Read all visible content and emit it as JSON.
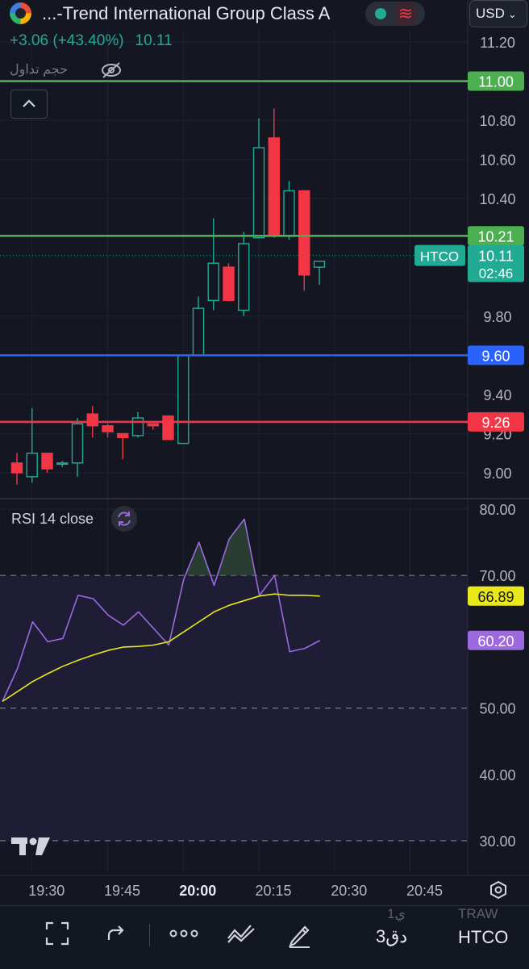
{
  "header": {
    "symbol_name": "...-Trend International Group Class A",
    "change": "+3.06 (+43.40%)",
    "last_price": "10.11",
    "volume_label": "حجم تداول",
    "currency": "USD",
    "currency_chevron": "⌄"
  },
  "colors": {
    "up": "#22ab94",
    "down": "#f23645",
    "green_line": "#4caf50",
    "blue_line": "#2962ff",
    "red_line": "#f23645",
    "rsi": "#9c6ade",
    "rsi_ma": "#e8e81a"
  },
  "price_axis": {
    "ticks": [
      "11.20",
      "10.80",
      "10.60",
      "10.40",
      "9.80",
      "9.40",
      "9.20",
      "9.00"
    ],
    "ylim": [
      8.94,
      11.26
    ]
  },
  "horizontal_lines": [
    {
      "price": 11.0,
      "label": "11.00",
      "color": "#4caf50"
    },
    {
      "price": 10.21,
      "label": "10.21",
      "color": "#4caf50"
    },
    {
      "price": 9.6,
      "label": "9.60",
      "color": "#2962ff"
    },
    {
      "price": 9.26,
      "label": "9.26",
      "color": "#f23645"
    }
  ],
  "last_price_tag": {
    "symbol": "HTCO",
    "price": "10.11",
    "countdown": "02:46",
    "value": 10.11
  },
  "chart_data": [
    {
      "type": "candlestick",
      "candles": [
        {
          "o": 9.05,
          "h": 9.1,
          "l": 8.94,
          "c": 9.0
        },
        {
          "o": 8.98,
          "h": 9.33,
          "l": 8.95,
          "c": 9.1
        },
        {
          "o": 9.1,
          "h": 9.1,
          "l": 9.0,
          "c": 9.02
        },
        {
          "o": 9.05,
          "h": 9.06,
          "l": 9.03,
          "c": 9.05
        },
        {
          "o": 9.05,
          "h": 9.28,
          "l": 8.98,
          "c": 9.25
        },
        {
          "o": 9.3,
          "h": 9.34,
          "l": 9.18,
          "c": 9.24
        },
        {
          "o": 9.24,
          "h": 9.25,
          "l": 9.18,
          "c": 9.21
        },
        {
          "o": 9.2,
          "h": 9.2,
          "l": 9.07,
          "c": 9.18
        },
        {
          "o": 9.19,
          "h": 9.31,
          "l": 9.18,
          "c": 9.28
        },
        {
          "o": 9.25,
          "h": 9.25,
          "l": 9.22,
          "c": 9.24
        },
        {
          "o": 9.29,
          "h": 9.29,
          "l": 9.17,
          "c": 9.17
        },
        {
          "o": 9.15,
          "h": 9.6,
          "l": 9.15,
          "c": 9.6
        },
        {
          "o": 9.6,
          "h": 9.9,
          "l": 9.6,
          "c": 9.84
        },
        {
          "o": 9.88,
          "h": 10.3,
          "l": 9.83,
          "c": 10.07
        },
        {
          "o": 10.05,
          "h": 10.07,
          "l": 9.88,
          "c": 9.88
        },
        {
          "o": 9.83,
          "h": 10.23,
          "l": 9.8,
          "c": 10.17
        },
        {
          "o": 10.2,
          "h": 10.81,
          "l": 10.2,
          "c": 10.66
        },
        {
          "o": 10.71,
          "h": 10.86,
          "l": 10.2,
          "c": 10.21
        },
        {
          "o": 10.21,
          "h": 10.49,
          "l": 10.19,
          "c": 10.44
        },
        {
          "o": 10.44,
          "h": 10.44,
          "l": 9.93,
          "c": 10.01
        },
        {
          "o": 10.05,
          "h": 10.08,
          "l": 9.96,
          "c": 10.08
        }
      ],
      "x_ticks": [
        {
          "label": "19:30",
          "index": 1
        },
        {
          "label": "19:45",
          "index": 6
        },
        {
          "label": "20:00",
          "index": 11,
          "bold": true
        },
        {
          "label": "20:15",
          "index": 16
        },
        {
          "label": "20:30",
          "index": 21
        },
        {
          "label": "20:45",
          "index": 26
        }
      ]
    },
    {
      "type": "line",
      "title": "RSI 14 close",
      "ylim": [
        28,
        81
      ],
      "yticks": [
        "80.00",
        "70.00",
        "50.00",
        "40.00",
        "30.00"
      ],
      "band": [
        30,
        70
      ],
      "series": [
        {
          "values": [
            51,
            56,
            63,
            60,
            60.5,
            67,
            66.5,
            64,
            62.5,
            64.5,
            62,
            59.5,
            69.5,
            75,
            68.5,
            75.5,
            78.5,
            67,
            70,
            58.5,
            59,
            60.2
          ],
          "last_label": "60.20"
        },
        {
          "values": [
            51,
            52.5,
            54,
            55.2,
            56.3,
            57.2,
            58,
            58.7,
            59.2,
            59.3,
            59.5,
            60,
            61.5,
            63,
            64.5,
            65.5,
            66.2,
            66.9,
            67.2,
            67,
            67,
            66.89
          ],
          "last_label": "66.89"
        }
      ]
    }
  ],
  "bottom_toolbar": {
    "interval": "3دق",
    "symbol": "HTCO",
    "ghost_left": "1ي",
    "ghost_right": "TRAW"
  }
}
